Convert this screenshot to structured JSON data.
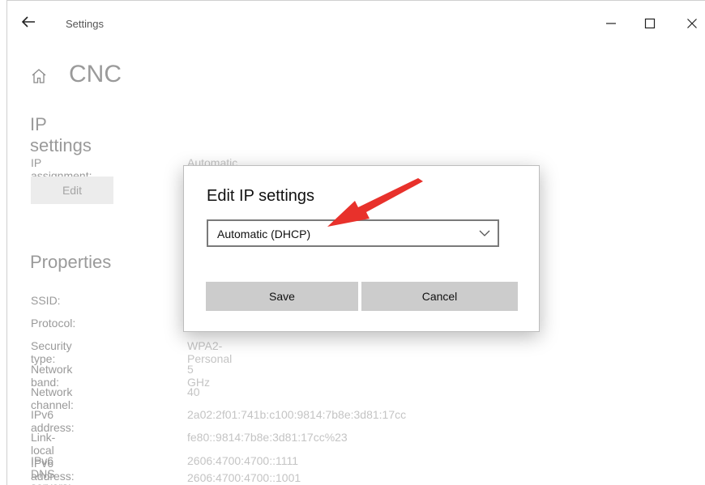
{
  "window": {
    "title": "Settings"
  },
  "page": {
    "title": "CNC"
  },
  "ip_settings": {
    "heading": "IP settings",
    "assignment_label": "IP assignment:",
    "assignment_value": "Automatic (DHCP)",
    "edit_label": "Edit"
  },
  "properties": {
    "heading": "Properties",
    "rows": [
      {
        "label": "SSID:",
        "value": ""
      },
      {
        "label": "Protocol:",
        "value": ""
      },
      {
        "label": "Security type:",
        "value": "WPA2-Personal"
      },
      {
        "label": "Network band:",
        "value": "5 GHz"
      },
      {
        "label": "Network channel:",
        "value": "40"
      },
      {
        "label": "IPv6 address:",
        "value": "2a02:2f01:741b:c100:9814:7b8e:3d81:17cc"
      },
      {
        "label": "Link-local IPv6 address:",
        "value": "fe80::9814:7b8e:3d81:17cc%23"
      },
      {
        "label": "IPv6 DNS servers:",
        "value": "2606:4700:4700::1111"
      }
    ],
    "dns_secondary": "2606:4700:4700::1001"
  },
  "dialog": {
    "title": "Edit IP settings",
    "selected_option": "Automatic (DHCP)",
    "save_label": "Save",
    "cancel_label": "Cancel"
  },
  "colors": {
    "annotation_arrow": "#e8312b"
  }
}
